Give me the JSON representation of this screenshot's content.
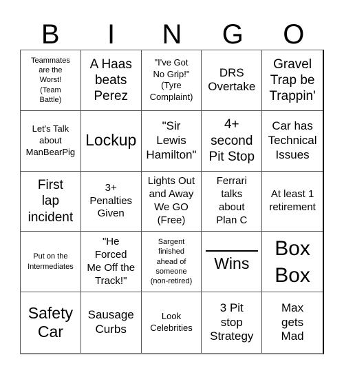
{
  "header": {
    "letters": [
      "B",
      "I",
      "N",
      "G",
      "O"
    ]
  },
  "cells": [
    {
      "text": "Teammates\nare the\nWorst!\n(Team\nBattle)"
    },
    {
      "text": "A Haas\nbeats\nPerez"
    },
    {
      "text": "\"I've Got\nNo Grip!\"\n(Tyre\nComplaint)"
    },
    {
      "text": "DRS\nOvertake"
    },
    {
      "text": "Gravel\nTrap be\nTrappin'"
    },
    {
      "text": "Let's Talk\nabout\nManBearPig"
    },
    {
      "text": "Lockup"
    },
    {
      "text": "\"Sir\nLewis\nHamilton\""
    },
    {
      "text": "4+\nsecond\nPit Stop"
    },
    {
      "text": "Car has\nTechnical\nIssues"
    },
    {
      "text": "First\nlap\nincident"
    },
    {
      "text": "3+\nPenalties\nGiven"
    },
    {
      "text": "Lights Out\nand Away\nWe GO\n(Free)"
    },
    {
      "text": "Ferrari\ntalks\nabout\nPlan C"
    },
    {
      "text": "At least 1\nretirement"
    },
    {
      "text": "Put on the\nIntermediates"
    },
    {
      "text": "\"He\nForced\nMe Off the\nTrack!\""
    },
    {
      "text": "Sargent\nfinished\nahead of\nsomeone\n(non-retired)"
    },
    {
      "text": "Wins",
      "blank_prefix": true
    },
    {
      "text": "Box\nBox"
    },
    {
      "text": "Safety\nCar"
    },
    {
      "text": "Sausage\nCurbs"
    },
    {
      "text": "Look\nCelebrities"
    },
    {
      "text": "3 Pit\nstop\nStrategy"
    },
    {
      "text": "Max\ngets\nMad"
    }
  ]
}
